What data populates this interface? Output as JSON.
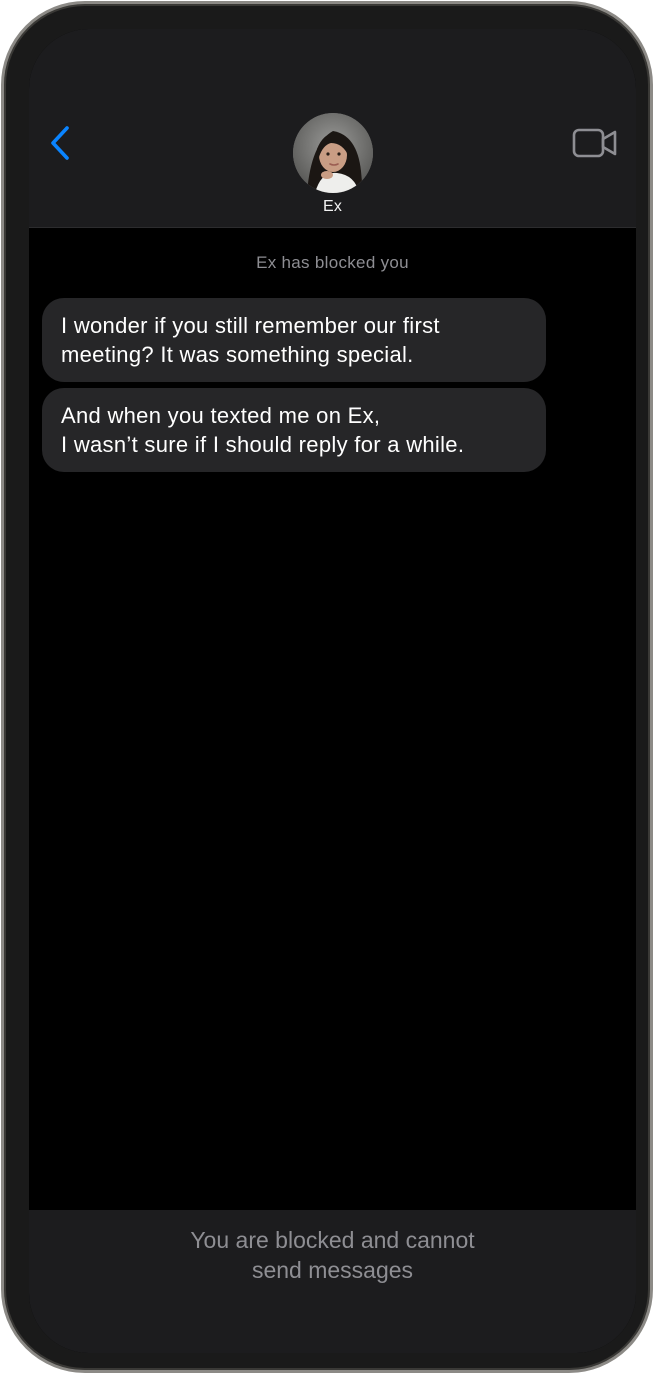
{
  "header": {
    "contact_name": "Ex",
    "icons": {
      "back": "chevron-left-icon",
      "video": "video-camera-icon"
    },
    "accent_color": "#0a84ff"
  },
  "conversation": {
    "status_note": "Ex has blocked you",
    "messages": [
      {
        "text": "I wonder if you still remember our first\nmeeting? It was something special."
      },
      {
        "text": "And when you texted me on Ex,\nI wasn’t sure if I should reply for a while."
      }
    ]
  },
  "footer": {
    "blocked_notice": "You are blocked and cannot\nsend messages"
  },
  "colors": {
    "screen_background": "#000000",
    "bar_background": "#1c1c1e",
    "bubble_background": "#262628",
    "secondary_text": "#8e8e93"
  }
}
